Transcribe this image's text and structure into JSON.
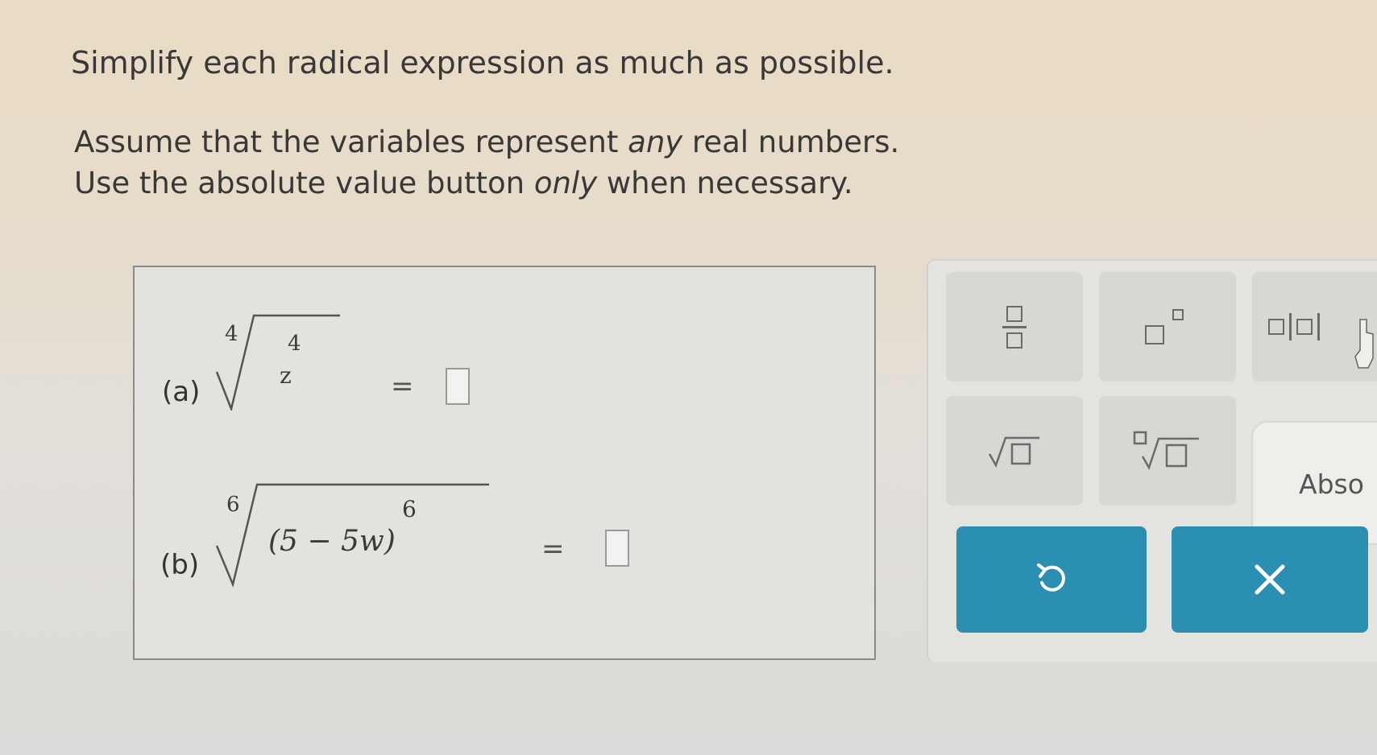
{
  "instructions": {
    "line1": "Simplify each radical expression as much as possible.",
    "line2_before": "Assume that the variables represent ",
    "line2_em": "any",
    "line2_after": " real numbers.",
    "line3_before": "Use the absolute value button ",
    "line3_em": "only",
    "line3_after": " when necessary."
  },
  "problems": [
    {
      "label": "(a)",
      "index": "4",
      "radicand": "z",
      "exponent": "4",
      "equals": "="
    },
    {
      "label": "(b)",
      "index": "6",
      "radicand": "(5 − 5w)",
      "exponent": "6",
      "equals": "="
    }
  ],
  "tooltip": {
    "text": "Abso"
  },
  "colors": {
    "action": "#2a8fb0",
    "palette_button": "#d8d7d4"
  }
}
